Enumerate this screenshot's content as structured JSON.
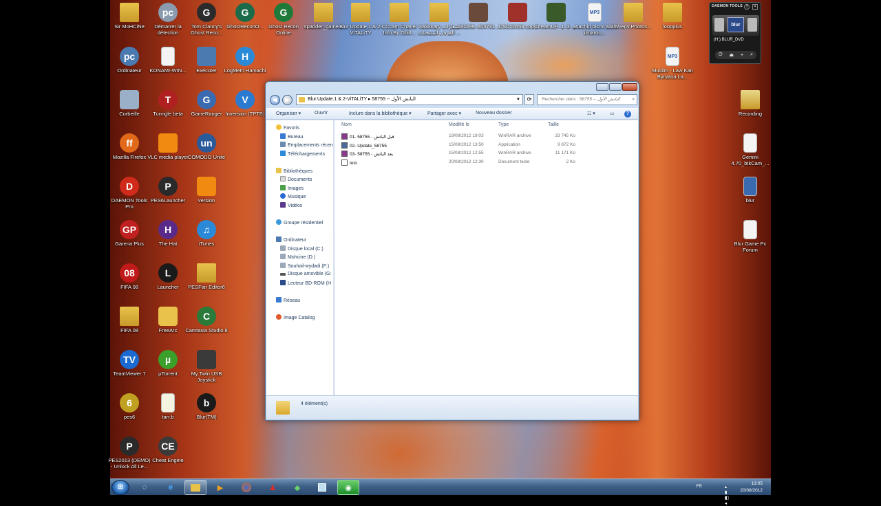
{
  "desktop": {
    "icons": [
      {
        "label": "Sir MoHCiNe",
        "glyph": "folder",
        "color": "#e8c24a"
      },
      {
        "label": "Démarrer la détection",
        "glyph": "pc",
        "color": "#8a9bb0"
      },
      {
        "label": "Tom Clancy's Ghost Reco...",
        "glyph": "G",
        "color": "#2b2b2b"
      },
      {
        "label": "GhostReconO...",
        "glyph": "G",
        "color": "#1b6b4a"
      },
      {
        "label": "Ghost Recon Online",
        "glyph": "G",
        "color": "#1f7a3a"
      },
      {
        "label": "spadder_game...",
        "glyph": "folder",
        "color": "#e8c24a"
      },
      {
        "label": "Blur Update.1 & 2-ViTALiTY",
        "glyph": "folder",
        "color": "#e8c24a"
      },
      {
        "label": "CCcam Chanel Info By Gbill...",
        "glyph": "folder",
        "color": "#e8c24a"
      },
      {
        "label": "3aSkkary شعارات الفرق والمنتخبات ...",
        "glyph": "folder",
        "color": "#e8c24a"
      },
      {
        "label": "181299_404731...",
        "glyph": "img",
        "color": "#6a4a3a"
      },
      {
        "label": "DSC00453 copy",
        "glyph": "img",
        "color": "#a0302a"
      },
      {
        "label": "DreamUP_1_3_...",
        "glyph": "img",
        "color": "#3a5a2a"
      },
      {
        "label": "anachid bismi allah ilmaroc...",
        "glyph": "mp3",
        "color": "#f4f4f4"
      },
      {
        "label": "M-egy Photos...",
        "glyph": "folder",
        "color": "#e8c24a"
      },
      {
        "label": "loopplus",
        "glyph": "folder",
        "color": "#e8c24a"
      },
      {
        "label": "Ordinateur",
        "glyph": "pc",
        "color": "#4a7ab0"
      },
      {
        "label": "KONAMI-WIN...",
        "glyph": "doc",
        "color": "#f4f4f4"
      },
      {
        "label": "Exécuter",
        "glyph": "run",
        "color": "#4a7ab0"
      },
      {
        "label": "LogMeIn Hamachi",
        "glyph": "H",
        "color": "#2a8ad8"
      },
      {
        "label": "Muslim - Law Kan Bynatna La...",
        "glyph": "mp3",
        "color": "#f4f4f4"
      },
      {
        "label": "Corbeille",
        "glyph": "bin",
        "color": "#9ab0c8"
      },
      {
        "label": "Tunngle beta",
        "glyph": "T",
        "color": "#b02020"
      },
      {
        "label": "GameRanger",
        "glyph": "G",
        "color": "#3a6ab0"
      },
      {
        "label": "Inversion (TPTB)",
        "glyph": "V",
        "color": "#2a7ad0"
      },
      {
        "label": "Recording",
        "glyph": "folder",
        "color": "#e8d88a"
      },
      {
        "label": "Mozilla Firefox",
        "glyph": "ff",
        "color": "#e06a1a"
      },
      {
        "label": "VLC media player",
        "glyph": "vlc",
        "color": "#f08a10"
      },
      {
        "label": "COMODO Unite",
        "glyph": "un",
        "color": "#2a5a9a"
      },
      {
        "label": "Gemini 4.70_btkCam_...",
        "glyph": "gem",
        "color": "#f4f4f4"
      },
      {
        "label": "DAEMON Tools Pro",
        "glyph": "D",
        "color": "#d02a1a"
      },
      {
        "label": "PES6Launcher",
        "glyph": "P",
        "color": "#2a2a2a"
      },
      {
        "label": "version",
        "glyph": "vlc",
        "color": "#f08a10"
      },
      {
        "label": "blur",
        "glyph": "doc",
        "color": "#3a6ab0"
      },
      {
        "label": "Garena Plus",
        "glyph": "GP",
        "color": "#c02020"
      },
      {
        "label": "The Hat",
        "glyph": "H",
        "color": "#5a2a8a"
      },
      {
        "label": "iTunes",
        "glyph": "♫",
        "color": "#2a8ad8"
      },
      {
        "label": "Blur Game Pc Forum",
        "glyph": "doc",
        "color": "#f4f4f4"
      },
      {
        "label": "FIFA 08",
        "glyph": "08",
        "color": "#c01a1a"
      },
      {
        "label": "Launcher",
        "glyph": "L",
        "color": "#1a1a1a"
      },
      {
        "label": "PESFan Editor6",
        "glyph": "folder",
        "color": "#e8c24a"
      },
      {
        "label": "FIFA 08",
        "glyph": "folder",
        "color": "#e8c24a"
      },
      {
        "label": "FreeArc",
        "glyph": "arc",
        "color": "#e8c24a"
      },
      {
        "label": "Camtasia Studio 8",
        "glyph": "C",
        "color": "#2a7a3a"
      },
      {
        "label": "TeamViewer 7",
        "glyph": "TV",
        "color": "#1a6ad0"
      },
      {
        "label": "µTorrent",
        "glyph": "µ",
        "color": "#3aa02a"
      },
      {
        "label": "My Twin USB Joystick",
        "glyph": "joy",
        "color": "#3a3a3a"
      },
      {
        "label": "pes6",
        "glyph": "6",
        "color": "#c0a020"
      },
      {
        "label": "tarr.b",
        "glyph": "doc",
        "color": "#f4f4e0"
      },
      {
        "label": "Blur(TM)",
        "glyph": "b",
        "color": "#1a1a1a"
      },
      {
        "label": "PES2013 (DEMO) - Unlock All Le...",
        "glyph": "P",
        "color": "#2a2a2a"
      },
      {
        "label": "Cheat Engine",
        "glyph": "CE",
        "color": "#3a3a3a"
      }
    ]
  },
  "daemon_gadget": {
    "title": "DAEMON TOOLS",
    "drive_label": "(H:) BLUR_DVD",
    "disc_label": "blur"
  },
  "explorer": {
    "address_path": "Blur.Update.1 & 2-ViTALiTY ▸ 58755 -- الباتش الأول",
    "search_placeholder": "Rechercher dans : 58755 -- الباتش الأول",
    "toolbar": {
      "organize": "Organiser ▾",
      "open": "Ouvrir",
      "include": "Inclure dans la bibliothèque ▾",
      "share": "Partager avec ▾",
      "new_folder": "Nouveau dossier"
    },
    "nav": {
      "favorites": "Favoris",
      "desktop": "Bureau",
      "recent": "Emplacements récen",
      "downloads": "Téléchargements",
      "libraries": "Bibliothèques",
      "documents": "Documents",
      "images": "Images",
      "music": "Musique",
      "videos": "Vidéos",
      "homegroup": "Groupe résidentiel",
      "computer": "Ordinateur",
      "disk_c": "Disque local (C:)",
      "disk_d": "Mohcine (D:)",
      "disk_f": "Souhail-wydadi (F:)",
      "disk_g": "Disque amovible (G:",
      "disk_h": "Lecteur BD-ROM (H",
      "network": "Réseau",
      "image_catalog": "Image Catalog"
    },
    "columns": {
      "name": "Nom",
      "modified": "Modifié le",
      "type": "Type",
      "size": "Taille"
    },
    "files": [
      {
        "name": "01- 58755 - قبل الباتش",
        "modified": "19/08/2012 19:03",
        "type": "WinRAR archive",
        "size": "33 745 Ko",
        "kind": "rar"
      },
      {
        "name": "02- Update_58755",
        "modified": "15/08/2012 13:50",
        "type": "Application",
        "size": "9 872 Ko",
        "kind": "app"
      },
      {
        "name": "03- 58755 - بعد الباتش",
        "modified": "15/08/2012 12:55",
        "type": "WinRAR archive",
        "size": "11 171 Ko",
        "kind": "rar"
      },
      {
        "name": "tuto",
        "modified": "20/08/2012 12:30",
        "type": "Document texte",
        "size": "2 Ko",
        "kind": "txt"
      }
    ],
    "status": "4 élément(s)"
  },
  "taskbar": {
    "lang": "FR",
    "time": "13:05",
    "date": "20/08/2012"
  }
}
